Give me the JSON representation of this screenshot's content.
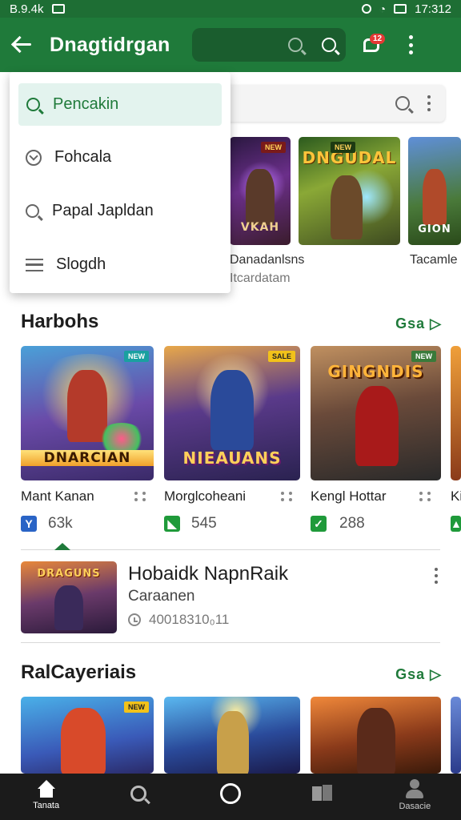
{
  "status": {
    "left": "B.9.4k",
    "time": "17:312"
  },
  "appbar": {
    "title": "Dnagtidrgan",
    "notification_count": "12"
  },
  "dropdown": {
    "items": [
      {
        "label": "Pencakin",
        "icon": "search-icon",
        "active": true
      },
      {
        "label": "Fohcala",
        "icon": "heart-icon",
        "active": false
      },
      {
        "label": "Papal Japldan",
        "icon": "search-icon",
        "active": false
      },
      {
        "label": "Slogdh",
        "icon": "list-icon",
        "active": false
      }
    ]
  },
  "top_row": {
    "cards": [
      {
        "art_title": "VKAH",
        "tag": "NEW"
      },
      {
        "art_title": "DNGUDAL",
        "tag": "NEW"
      },
      {
        "art_title": "GION"
      }
    ],
    "captions": [
      "Danadanlsns",
      "Itcardatam",
      "Tacamle"
    ]
  },
  "section1": {
    "title": "Harbohs",
    "more_label": "Gsa ▷",
    "games": [
      {
        "name": "Mant Kanan",
        "stat": "63k",
        "stat_icon": "Y",
        "stat_color": "#2a64c6",
        "art_title": "DNARCIAN",
        "tag": "NEW"
      },
      {
        "name": "Morglcoheani",
        "stat": "545",
        "stat_icon": "◣",
        "stat_color": "#1f9a3a",
        "art_title": "NIEAUANS",
        "tag": "SALE"
      },
      {
        "name": "Kengl Hottar",
        "stat": "288",
        "stat_icon": "✓",
        "stat_color": "#1f9a3a",
        "art_title": "GINGNDIS",
        "tag": "NEW"
      },
      {
        "name": "Ki",
        "stat_icon": "▲",
        "stat_color": "#1f9a3a"
      }
    ]
  },
  "featured": {
    "title": "Hobaidk NapnRaik",
    "subtitle": "Caraanen",
    "meta": "40018310₀11",
    "art_title": "DRAGUNS"
  },
  "section2": {
    "title": "RalCayeriais",
    "more_label": "Gsa ▷",
    "cards": [
      {
        "tag": "NEW"
      },
      {
        "tag": ""
      },
      {
        "tag": ""
      }
    ]
  },
  "bottom_nav": {
    "items": [
      {
        "label": "Tanata",
        "icon": "home-icon",
        "active": true
      },
      {
        "label": "",
        "icon": "search-icon",
        "active": false
      },
      {
        "label": "",
        "icon": "circle-icon",
        "active": false
      },
      {
        "label": "",
        "icon": "library-icon",
        "active": false
      },
      {
        "label": "Dasacie",
        "icon": "user-icon",
        "active": false
      }
    ]
  },
  "colors": {
    "primary": "#1f7a3a",
    "primary_dark": "#1e6e34",
    "accent_light": "#e3f3ee"
  }
}
